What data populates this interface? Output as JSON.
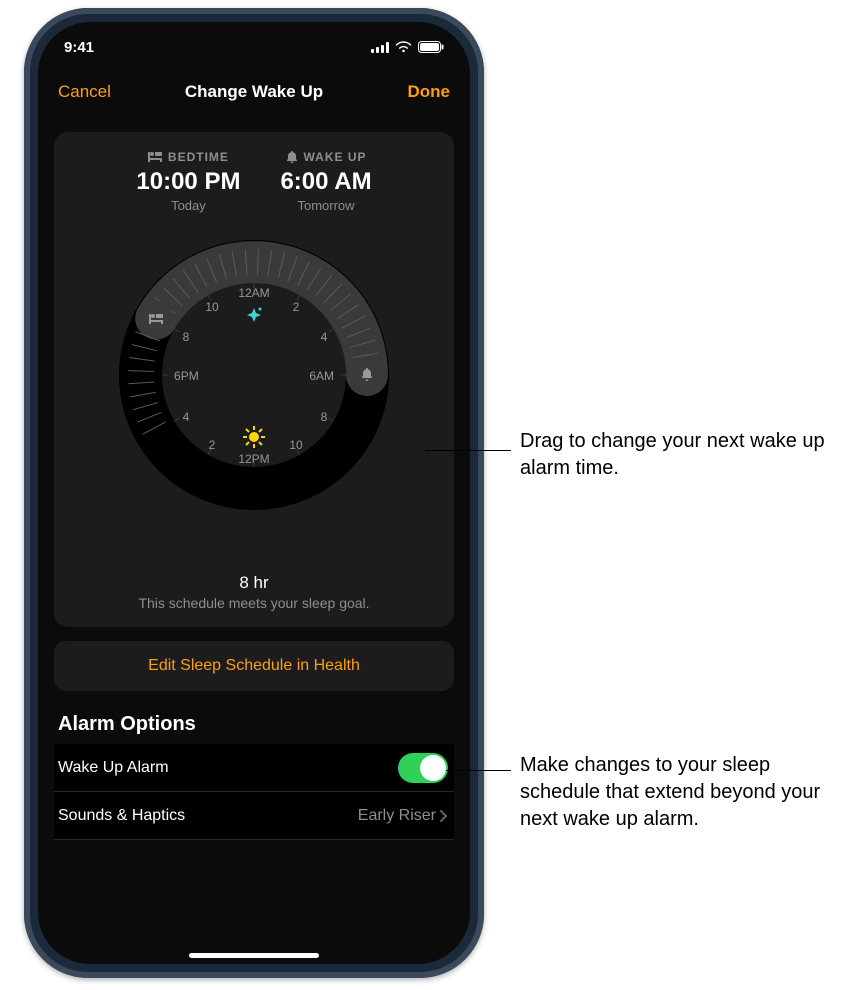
{
  "status": {
    "time": "9:41"
  },
  "nav": {
    "cancel": "Cancel",
    "title": "Change Wake Up",
    "done": "Done"
  },
  "bedtime": {
    "label": "BEDTIME",
    "time": "10:00 PM",
    "day": "Today"
  },
  "wakeup": {
    "label": "WAKE UP",
    "time": "6:00 AM",
    "day": "Tomorrow"
  },
  "dial": {
    "top": "12",
    "topSuffix": "AM",
    "right": "6",
    "rightSuffix": "AM",
    "bottom": "12",
    "bottomSuffix": "PM",
    "left": "6",
    "leftSuffix": "PM",
    "n2": "2",
    "n4": "4",
    "n8": "8",
    "n10": "10"
  },
  "goal": {
    "hours": "8 hr",
    "sub": "This schedule meets your sleep goal."
  },
  "editHealth": "Edit Sleep Schedule in Health",
  "section": "Alarm Options",
  "rowAlarm": "Wake Up Alarm",
  "rowSounds": {
    "label": "Sounds & Haptics",
    "value": "Early Riser"
  },
  "callout1": "Drag to change your next wake up alarm time.",
  "callout2": "Make changes to your sleep schedule that extend beyond your next wake up alarm."
}
